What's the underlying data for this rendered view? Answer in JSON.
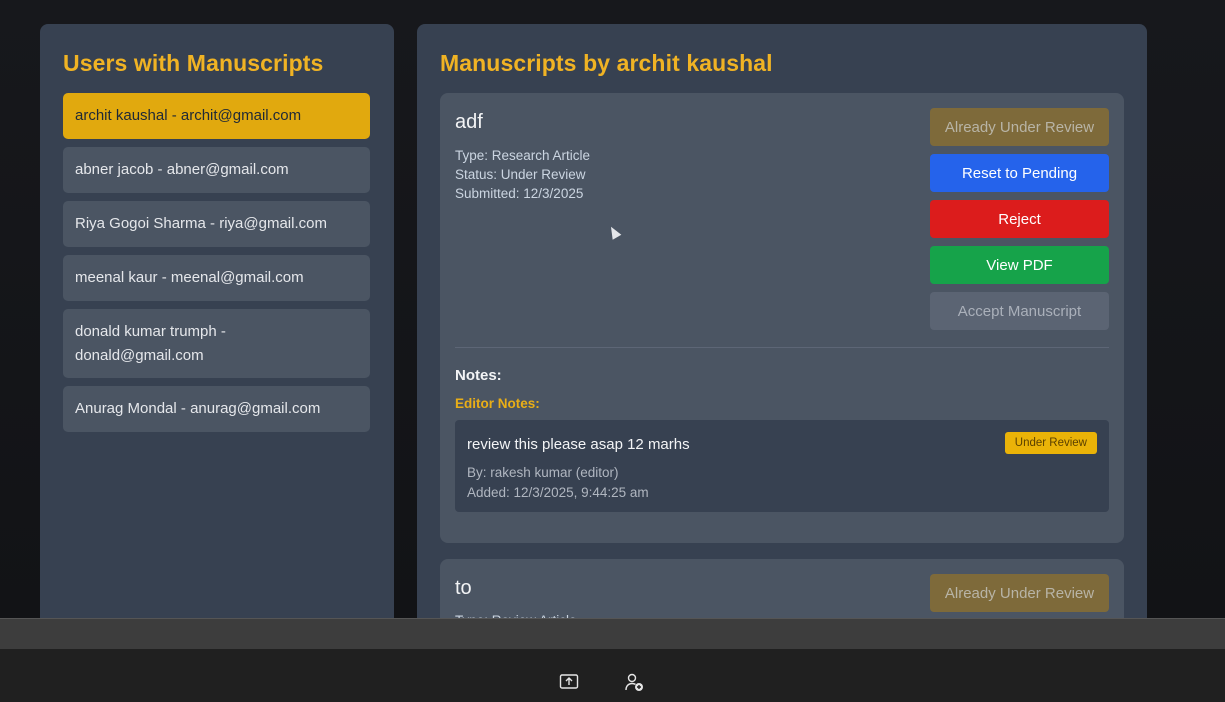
{
  "users_panel": {
    "title": "Users with Manuscripts",
    "users": [
      {
        "label": "archit kaushal - archit@gmail.com",
        "active": true
      },
      {
        "label": "abner jacob - abner@gmail.com",
        "active": false
      },
      {
        "label": "Riya Gogoi Sharma - riya@gmail.com",
        "active": false
      },
      {
        "label": "meenal kaur - meenal@gmail.com",
        "active": false
      },
      {
        "label": "donald kumar trumph - donald@gmail.com",
        "active": false
      },
      {
        "label": "Anurag Mondal - anurag@gmail.com",
        "active": false
      }
    ]
  },
  "manuscripts_panel": {
    "title": "Manuscripts by archit kaushal",
    "manuscripts": [
      {
        "title": "adf",
        "type": "Type: Research Article",
        "status": "Status: Under Review",
        "submitted": "Submitted: 12/3/2025",
        "buttons": {
          "review": "Already Under Review",
          "reset": "Reset to Pending",
          "reject": "Reject",
          "pdf": "View PDF",
          "accept": "Accept Manuscript"
        },
        "notes_heading": "Notes:",
        "editor_notes_label": "Editor Notes:",
        "note": {
          "text": "review this please asap 12 marhs",
          "by": "By: rakesh kumar (editor)",
          "added": "Added: 12/3/2025, 9:44:25 am",
          "badge": "Under Review"
        }
      },
      {
        "title": "to",
        "type": "Type: Review Article",
        "buttons": {
          "review": "Already Under Review"
        }
      }
    ]
  },
  "taskbar": {
    "icons": [
      "share-screen-icon",
      "add-person-icon"
    ]
  },
  "colors": {
    "accent": "#f0b324",
    "panel": "#374151",
    "card": "#4b5563",
    "active_user": "#e1a90e",
    "reset": "#2563eb",
    "reject": "#dc1c1c",
    "pdf": "#16a34a"
  }
}
